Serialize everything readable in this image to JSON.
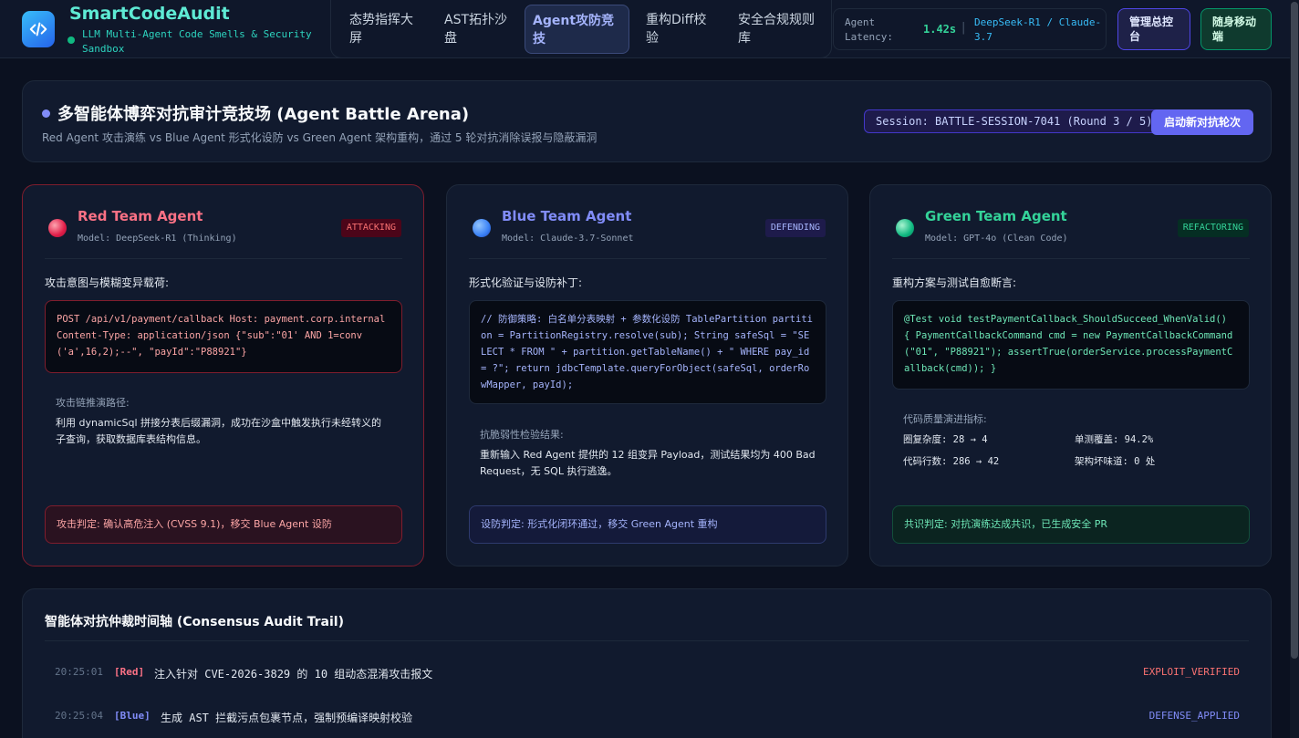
{
  "header": {
    "brand_title": "SmartCodeAudit",
    "brand_subtitle": "LLM Multi-Agent Code Smells & Security Sandbox",
    "nav_tabs": [
      {
        "label": "态势指挥大屏",
        "active": false
      },
      {
        "label": "AST拓扑沙盘",
        "active": false
      },
      {
        "label": "Agent攻防竞技",
        "active": true
      },
      {
        "label": "重构Diff校验",
        "active": false
      },
      {
        "label": "安全合规规则库",
        "active": false
      }
    ],
    "latency_label": "Agent Latency:",
    "latency_value": "1.42s",
    "latency_separator": "|",
    "model_pair": "DeepSeek-R1 / Claude-3.7",
    "admin_button": "管理总控台",
    "mobile_button": "随身移动端"
  },
  "banner": {
    "title": "多智能体博弈对抗审计竞技场 (Agent Battle Arena)",
    "subtitle": "Red Agent 攻击演练 vs Blue Agent 形式化设防 vs Green Agent 架构重构，通过 5 轮对抗消除误报与隐蔽漏洞",
    "session": "Session: BATTLE-SESSION-7041 (Round 3 / 5)",
    "start_button": "启动新对抗轮次"
  },
  "agents": {
    "red": {
      "name": "Red Team Agent",
      "model": "Model: DeepSeek-R1 (Thinking)",
      "status": "ATTACKING",
      "section_label": "攻击意图与模糊变异载荷:",
      "code": "POST /api/v1/payment/callback Host: payment.corp.internal Content-Type: application/json {\"sub\":\"01' AND 1=conv('a',16,2);--\", \"payId\":\"P88921\"}",
      "info_label": "攻击链推演路径:",
      "info_body": "利用 dynamicSql 拼接分表后缀漏洞，成功在沙盒中触发执行未经转义的子查询，获取数据库表结构信息。",
      "verdict": "攻击判定: 确认高危注入 (CVSS 9.1)，移交 Blue Agent 设防"
    },
    "blue": {
      "name": "Blue Team Agent",
      "model": "Model: Claude-3.7-Sonnet",
      "status": "DEFENDING",
      "section_label": "形式化验证与设防补丁:",
      "code": "// 防御策略: 白名单分表映射 + 参数化设防 TablePartition partition = PartitionRegistry.resolve(sub); String safeSql = \"SELECT * FROM \" + partition.getTableName() + \" WHERE pay_id = ?\"; return jdbcTemplate.queryForObject(safeSql, orderRowMapper, payId);",
      "info_label": "抗脆弱性检验结果:",
      "info_body": "重新输入 Red Agent 提供的 12 组变异 Payload，测试结果均为 400 Bad Request，无 SQL 执行逃逸。",
      "verdict": "设防判定: 形式化闭环通过，移交 Green Agent 重构"
    },
    "green": {
      "name": "Green Team Agent",
      "model": "Model: GPT-4o (Clean Code)",
      "status": "REFACTORING",
      "section_label": "重构方案与测试自愈断言:",
      "code": "@Test void testPaymentCallback_ShouldSucceed_WhenValid() { PaymentCallbackCommand cmd = new PaymentCallbackCommand(\"01\", \"P88921\"); assertTrue(orderService.processPaymentCallback(cmd)); }",
      "info_label": "代码质量演进指标:",
      "metrics": [
        "圈复杂度: 28 → 4",
        "单测覆盖: 94.2%",
        "代码行数: 286 → 42",
        "架构坏味道: 0 处"
      ],
      "verdict": "共识判定: 对抗演练达成共识，已生成安全 PR"
    }
  },
  "timeline": {
    "title": "智能体对抗仲裁时间轴 (Consensus Audit Trail)",
    "events": [
      {
        "time": "20:25:01",
        "who": "[Red]",
        "message": "注入针对 CVE-2026-3829 的 10 组动态混淆攻击报文",
        "status": "EXPLOIT_VERIFIED"
      },
      {
        "time": "20:25:04",
        "who": "[Blue]",
        "message": "生成 AST 拦截污点包裹节点，强制预编译映射校验",
        "status": "DEFENSE_APPLIED"
      }
    ]
  },
  "colors": {
    "red": "#f87171",
    "blue": "#818cf8",
    "green": "#34d399",
    "accent": "#6366f1"
  }
}
